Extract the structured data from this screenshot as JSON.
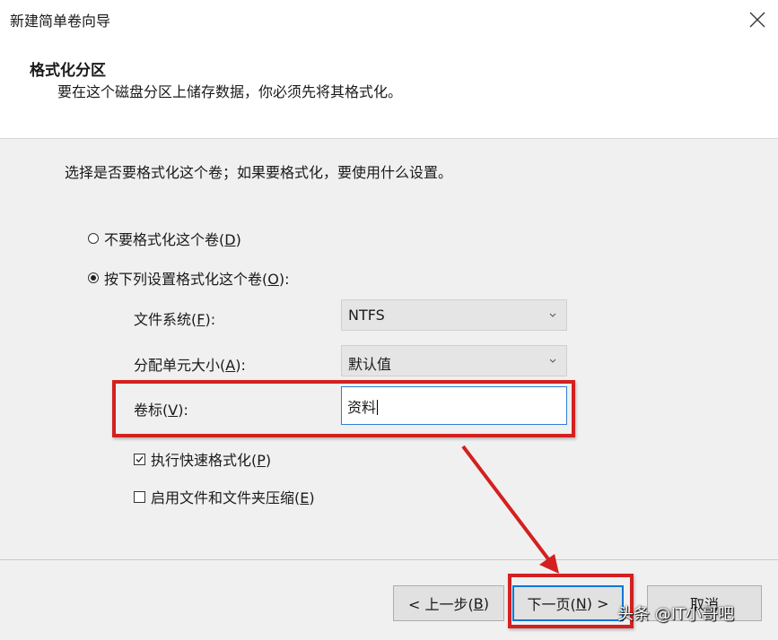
{
  "window": {
    "title": "新建简单卷向导"
  },
  "header": {
    "title": "格式化分区",
    "subtitle": "要在这个磁盘分区上储存数据，你必须先将其格式化。"
  },
  "content": {
    "prompt": "选择是否要格式化这个卷；如果要格式化，要使用什么设置。",
    "radio_no_format": {
      "text": "不要格式化这个卷(",
      "key": "D",
      "end": ")",
      "selected": false
    },
    "radio_format": {
      "text": "按下列设置格式化这个卷(",
      "key": "O",
      "end": "):",
      "selected": true
    },
    "file_system": {
      "label": "文件系统(",
      "key": "F",
      "end": "):",
      "value": "NTFS"
    },
    "allocation_unit": {
      "label": "分配单元大小(",
      "key": "A",
      "end": "):",
      "value": "默认值"
    },
    "volume_label": {
      "label": "卷标(",
      "key": "V",
      "end": "):",
      "value": "资料"
    },
    "quick_format": {
      "text": "执行快速格式化(",
      "key": "P",
      "end": ")",
      "checked": true
    },
    "compression": {
      "text": "启用文件和文件夹压缩(",
      "key": "E",
      "end": ")",
      "checked": false
    }
  },
  "buttons": {
    "back": {
      "text": "< 上一步(",
      "key": "B",
      "end": ")"
    },
    "next": {
      "text": "下一页(",
      "key": "N",
      "end": ") >"
    },
    "cancel": {
      "text": "取消"
    }
  },
  "watermark": "头条 @IT小哥吧",
  "colors": {
    "highlight": "#d42020",
    "focus": "#0078d7",
    "panel": "#f0f0f0"
  },
  "icons": {
    "close": "close-icon",
    "dropdown": "chevron-down-icon",
    "checkmark": "checkmark-icon"
  }
}
